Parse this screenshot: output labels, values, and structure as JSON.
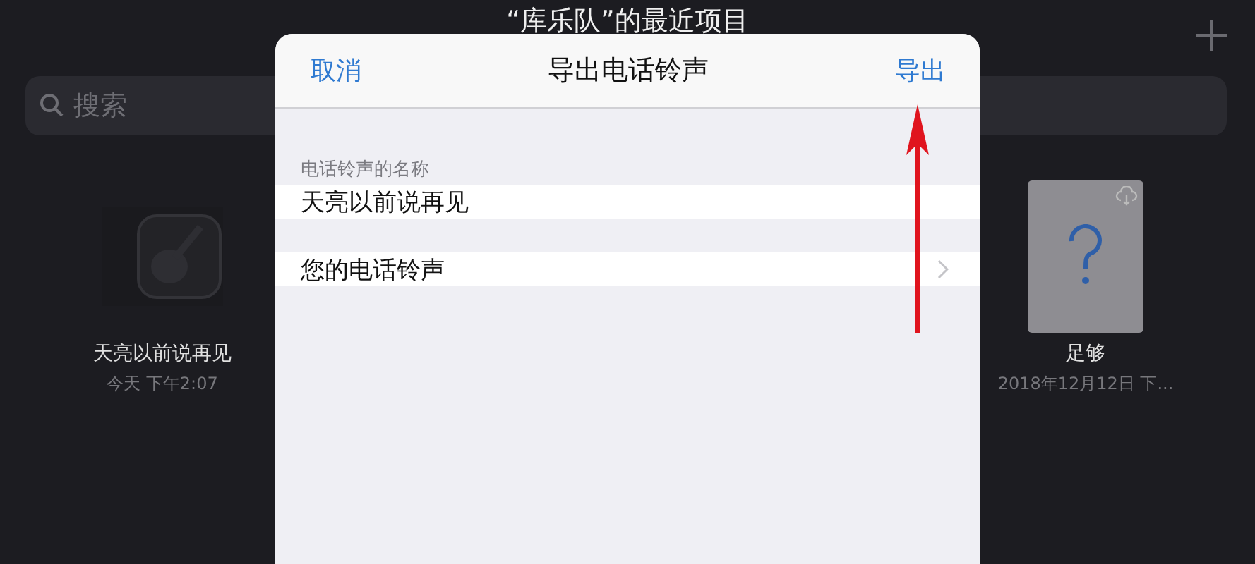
{
  "background": {
    "title": "“库乐队”的最近项目",
    "search": {
      "placeholder": "搜索"
    },
    "projects": [
      {
        "kind": "guitar",
        "name": "天亮以前说再见",
        "date": "今天 下午2:07"
      },
      {
        "kind": "unknown",
        "name": "足够",
        "date": "2018年12月12日 下..."
      }
    ]
  },
  "dialog": {
    "title": "导出电话铃声",
    "cancel": "取消",
    "confirm": "导出",
    "section_label": "电话铃声的名称",
    "name_value": "天亮以前说再见",
    "ringtones_row": "您的电话铃声"
  }
}
